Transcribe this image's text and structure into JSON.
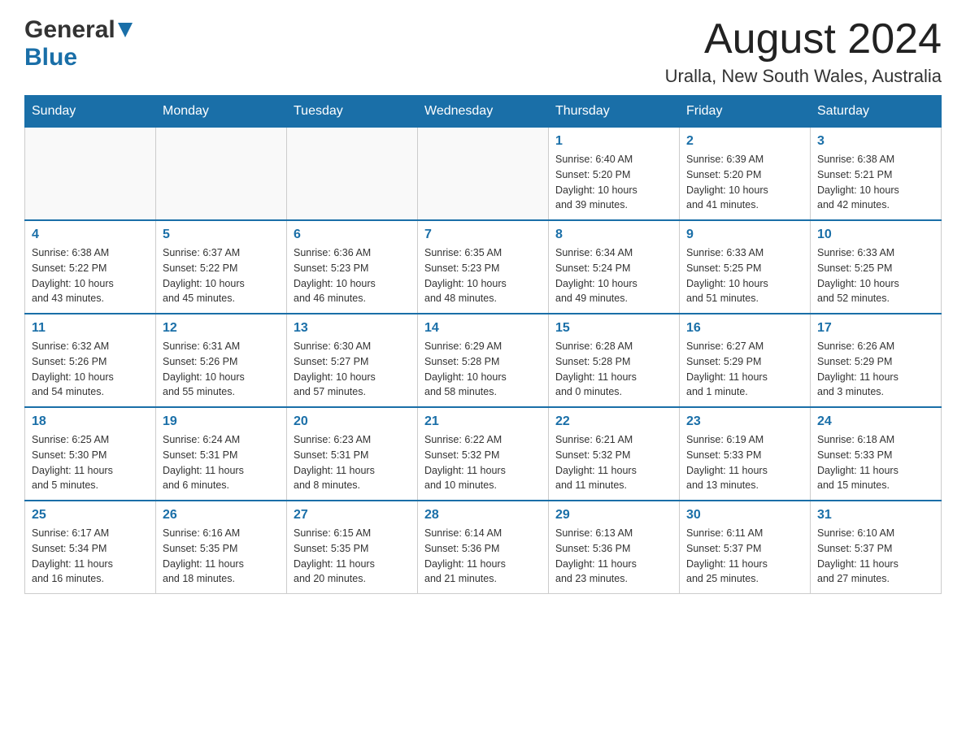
{
  "header": {
    "logo_general": "General",
    "logo_blue": "Blue",
    "month_title": "August 2024",
    "location": "Uralla, New South Wales, Australia"
  },
  "days_of_week": [
    "Sunday",
    "Monday",
    "Tuesday",
    "Wednesday",
    "Thursday",
    "Friday",
    "Saturday"
  ],
  "weeks": [
    [
      {
        "day": "",
        "info": ""
      },
      {
        "day": "",
        "info": ""
      },
      {
        "day": "",
        "info": ""
      },
      {
        "day": "",
        "info": ""
      },
      {
        "day": "1",
        "info": "Sunrise: 6:40 AM\nSunset: 5:20 PM\nDaylight: 10 hours\nand 39 minutes."
      },
      {
        "day": "2",
        "info": "Sunrise: 6:39 AM\nSunset: 5:20 PM\nDaylight: 10 hours\nand 41 minutes."
      },
      {
        "day": "3",
        "info": "Sunrise: 6:38 AM\nSunset: 5:21 PM\nDaylight: 10 hours\nand 42 minutes."
      }
    ],
    [
      {
        "day": "4",
        "info": "Sunrise: 6:38 AM\nSunset: 5:22 PM\nDaylight: 10 hours\nand 43 minutes."
      },
      {
        "day": "5",
        "info": "Sunrise: 6:37 AM\nSunset: 5:22 PM\nDaylight: 10 hours\nand 45 minutes."
      },
      {
        "day": "6",
        "info": "Sunrise: 6:36 AM\nSunset: 5:23 PM\nDaylight: 10 hours\nand 46 minutes."
      },
      {
        "day": "7",
        "info": "Sunrise: 6:35 AM\nSunset: 5:23 PM\nDaylight: 10 hours\nand 48 minutes."
      },
      {
        "day": "8",
        "info": "Sunrise: 6:34 AM\nSunset: 5:24 PM\nDaylight: 10 hours\nand 49 minutes."
      },
      {
        "day": "9",
        "info": "Sunrise: 6:33 AM\nSunset: 5:25 PM\nDaylight: 10 hours\nand 51 minutes."
      },
      {
        "day": "10",
        "info": "Sunrise: 6:33 AM\nSunset: 5:25 PM\nDaylight: 10 hours\nand 52 minutes."
      }
    ],
    [
      {
        "day": "11",
        "info": "Sunrise: 6:32 AM\nSunset: 5:26 PM\nDaylight: 10 hours\nand 54 minutes."
      },
      {
        "day": "12",
        "info": "Sunrise: 6:31 AM\nSunset: 5:26 PM\nDaylight: 10 hours\nand 55 minutes."
      },
      {
        "day": "13",
        "info": "Sunrise: 6:30 AM\nSunset: 5:27 PM\nDaylight: 10 hours\nand 57 minutes."
      },
      {
        "day": "14",
        "info": "Sunrise: 6:29 AM\nSunset: 5:28 PM\nDaylight: 10 hours\nand 58 minutes."
      },
      {
        "day": "15",
        "info": "Sunrise: 6:28 AM\nSunset: 5:28 PM\nDaylight: 11 hours\nand 0 minutes."
      },
      {
        "day": "16",
        "info": "Sunrise: 6:27 AM\nSunset: 5:29 PM\nDaylight: 11 hours\nand 1 minute."
      },
      {
        "day": "17",
        "info": "Sunrise: 6:26 AM\nSunset: 5:29 PM\nDaylight: 11 hours\nand 3 minutes."
      }
    ],
    [
      {
        "day": "18",
        "info": "Sunrise: 6:25 AM\nSunset: 5:30 PM\nDaylight: 11 hours\nand 5 minutes."
      },
      {
        "day": "19",
        "info": "Sunrise: 6:24 AM\nSunset: 5:31 PM\nDaylight: 11 hours\nand 6 minutes."
      },
      {
        "day": "20",
        "info": "Sunrise: 6:23 AM\nSunset: 5:31 PM\nDaylight: 11 hours\nand 8 minutes."
      },
      {
        "day": "21",
        "info": "Sunrise: 6:22 AM\nSunset: 5:32 PM\nDaylight: 11 hours\nand 10 minutes."
      },
      {
        "day": "22",
        "info": "Sunrise: 6:21 AM\nSunset: 5:32 PM\nDaylight: 11 hours\nand 11 minutes."
      },
      {
        "day": "23",
        "info": "Sunrise: 6:19 AM\nSunset: 5:33 PM\nDaylight: 11 hours\nand 13 minutes."
      },
      {
        "day": "24",
        "info": "Sunrise: 6:18 AM\nSunset: 5:33 PM\nDaylight: 11 hours\nand 15 minutes."
      }
    ],
    [
      {
        "day": "25",
        "info": "Sunrise: 6:17 AM\nSunset: 5:34 PM\nDaylight: 11 hours\nand 16 minutes."
      },
      {
        "day": "26",
        "info": "Sunrise: 6:16 AM\nSunset: 5:35 PM\nDaylight: 11 hours\nand 18 minutes."
      },
      {
        "day": "27",
        "info": "Sunrise: 6:15 AM\nSunset: 5:35 PM\nDaylight: 11 hours\nand 20 minutes."
      },
      {
        "day": "28",
        "info": "Sunrise: 6:14 AM\nSunset: 5:36 PM\nDaylight: 11 hours\nand 21 minutes."
      },
      {
        "day": "29",
        "info": "Sunrise: 6:13 AM\nSunset: 5:36 PM\nDaylight: 11 hours\nand 23 minutes."
      },
      {
        "day": "30",
        "info": "Sunrise: 6:11 AM\nSunset: 5:37 PM\nDaylight: 11 hours\nand 25 minutes."
      },
      {
        "day": "31",
        "info": "Sunrise: 6:10 AM\nSunset: 5:37 PM\nDaylight: 11 hours\nand 27 minutes."
      }
    ]
  ]
}
